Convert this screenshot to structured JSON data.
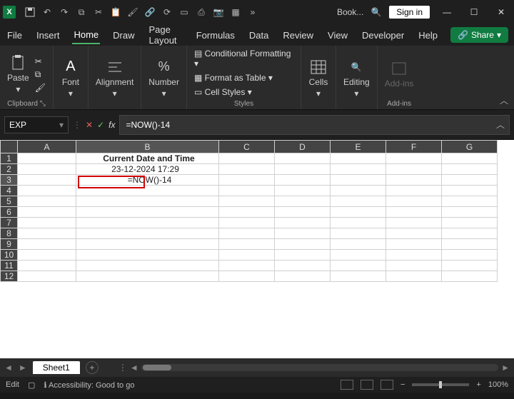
{
  "titlebar": {
    "app_letter": "X",
    "book_name": "Book...",
    "signin": "Sign in"
  },
  "tabs": {
    "file": "File",
    "insert": "Insert",
    "home": "Home",
    "draw": "Draw",
    "page_layout": "Page Layout",
    "formulas": "Formulas",
    "data": "Data",
    "review": "Review",
    "view": "View",
    "developer": "Developer",
    "help": "Help",
    "share": "Share"
  },
  "ribbon": {
    "clipboard": {
      "paste": "Paste",
      "label": "Clipboard"
    },
    "font": {
      "btn": "Font"
    },
    "alignment": {
      "btn": "Alignment"
    },
    "number": {
      "btn": "Number"
    },
    "styles": {
      "cond": "Conditional Formatting",
      "table": "Format as Table",
      "cell": "Cell Styles",
      "label": "Styles"
    },
    "cells": {
      "btn": "Cells"
    },
    "editing": {
      "btn": "Editing"
    },
    "addins": {
      "btn": "Add-ins",
      "label": "Add-ins"
    }
  },
  "formula_bar": {
    "name_box": "EXP",
    "formula": "=NOW()-14"
  },
  "grid": {
    "columns": [
      "A",
      "B",
      "C",
      "D",
      "E",
      "F",
      "G"
    ],
    "rows": [
      "1",
      "2",
      "3",
      "4",
      "5",
      "6",
      "7",
      "8",
      "9",
      "10",
      "11",
      "12"
    ],
    "b1": "Current Date and Time",
    "b2": "23-12-2024 17:29",
    "b3": "=NOW()-14"
  },
  "sheet_tabs": {
    "sheet1": "Sheet1"
  },
  "status": {
    "mode": "Edit",
    "access": "Accessibility: Good to go",
    "zoom": "100%"
  }
}
